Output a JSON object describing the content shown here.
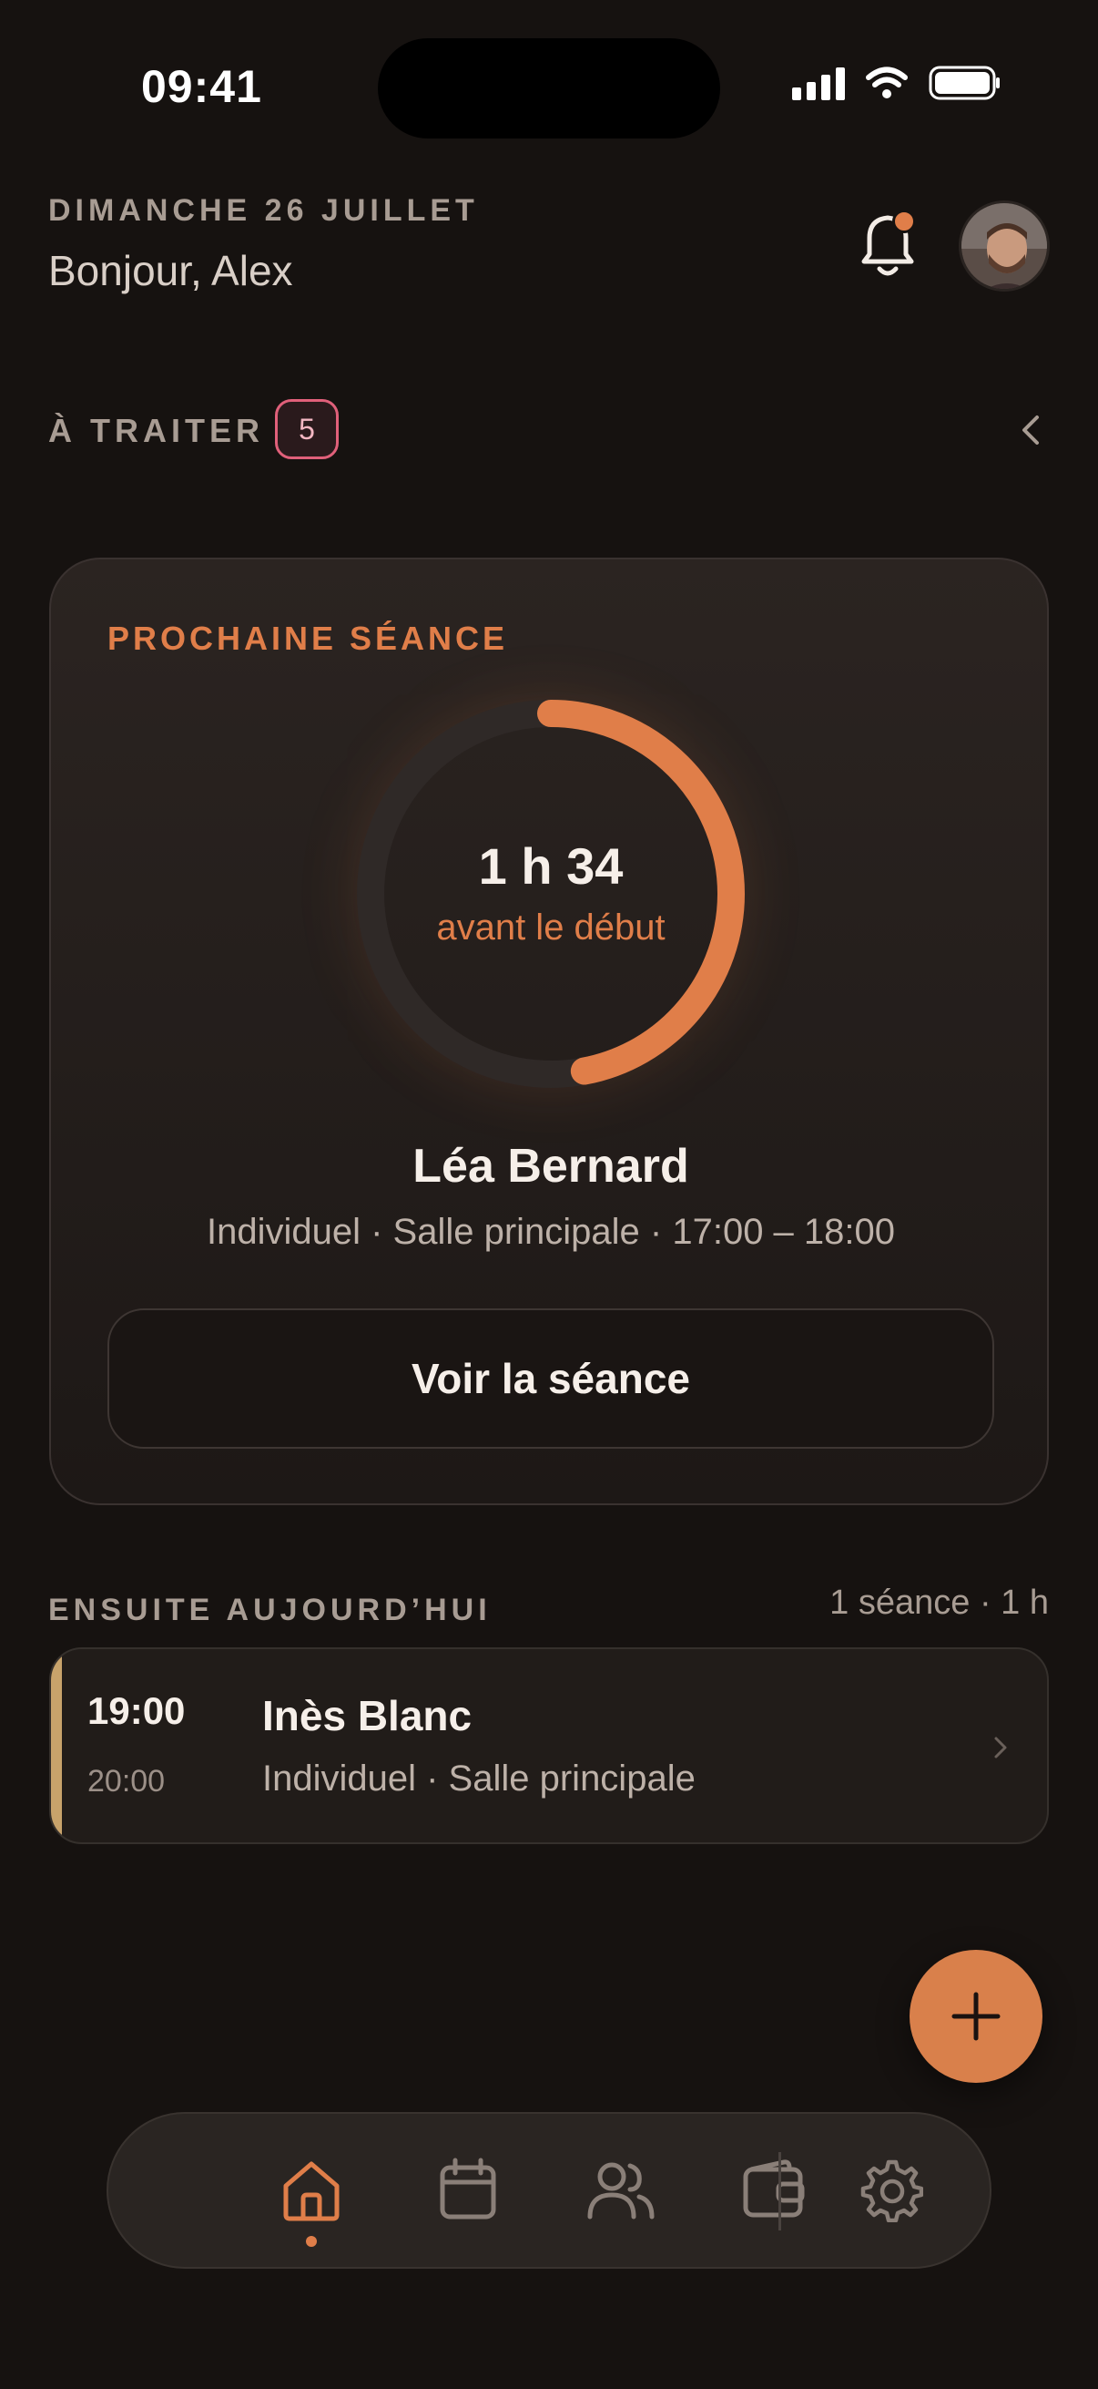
{
  "status_bar": {
    "time": "09:41"
  },
  "header": {
    "date": "DIMANCHE 26 JUILLET",
    "greeting": "Bonjour, Alex",
    "notification_icon": "bell-icon",
    "has_notification": true
  },
  "todo": {
    "label": "À TRAITER",
    "count": "5"
  },
  "next_session": {
    "label": "PROCHAINE SÉANCE",
    "countdown": "1 h 34",
    "countdown_sub": "avant le début",
    "progress": 0.47,
    "client": "Léa Bernard",
    "details": "Individuel · Salle principale · 17:00 – 18:00",
    "button": "Voir la séance"
  },
  "later": {
    "label": "ENSUITE AUJOURD’HUI",
    "summary": "1 séance · 1 h",
    "items": [
      {
        "start": "19:00",
        "end": "20:00",
        "name": "Inès Blanc",
        "details": "Individuel · Salle principale"
      }
    ]
  },
  "fab": {
    "icon": "plus-icon"
  },
  "nav": {
    "items": [
      {
        "icon": "home-icon",
        "active": true
      },
      {
        "icon": "calendar-icon",
        "active": false
      },
      {
        "icon": "users-icon",
        "active": false
      },
      {
        "icon": "wallet-icon",
        "active": false
      },
      {
        "icon": "gear-icon",
        "active": false
      }
    ]
  },
  "colors": {
    "accent": "#e07e49",
    "background": "#161210",
    "badge": "#e0607a",
    "row_bar": "#c8a36b"
  }
}
